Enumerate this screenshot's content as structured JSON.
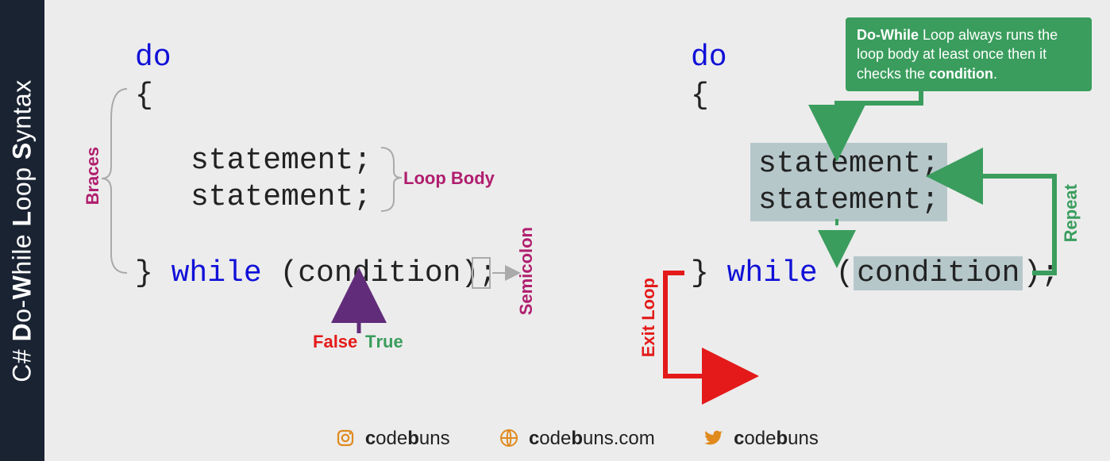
{
  "sidebar": {
    "text_plain": "C# Do-While Loop Syntax"
  },
  "left_code": {
    "kw_do": "do",
    "open_brace": "{",
    "stmt1": "statement;",
    "stmt2": "statement;",
    "close": "} ",
    "kw_while": "while",
    "cond": " (condition)",
    "semi": ";"
  },
  "right_code": {
    "kw_do": "do",
    "open_brace": "{",
    "stmt1": "statement;",
    "stmt2": "statement;",
    "close": "} ",
    "kw_while": "while",
    "cond_open": " (",
    "cond_word": "condition",
    "cond_close": ");"
  },
  "labels": {
    "braces": "Braces",
    "loop_body": "Loop Body",
    "false": "False",
    "true": "True",
    "semicolon": "Semicolon",
    "exit_loop": "Exit Loop",
    "repeat": "Repeat"
  },
  "tooltip": {
    "bold1": "Do-While",
    "mid": " Loop always runs the loop body at least once then it checks the ",
    "bold2": "condition",
    "end": "."
  },
  "footer": {
    "ig": "codebuns",
    "web": "codebuns.com",
    "tw": "codebuns"
  }
}
